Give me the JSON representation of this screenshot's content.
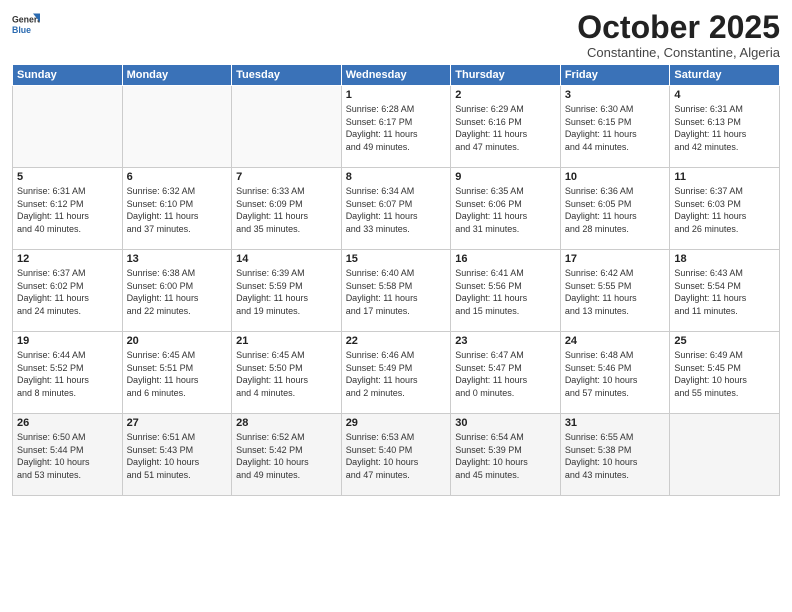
{
  "header": {
    "logo_general": "General",
    "logo_blue": "Blue",
    "month_title": "October 2025",
    "subtitle": "Constantine, Constantine, Algeria"
  },
  "weekdays": [
    "Sunday",
    "Monday",
    "Tuesday",
    "Wednesday",
    "Thursday",
    "Friday",
    "Saturday"
  ],
  "weeks": [
    [
      {
        "day": "",
        "info": ""
      },
      {
        "day": "",
        "info": ""
      },
      {
        "day": "",
        "info": ""
      },
      {
        "day": "1",
        "info": "Sunrise: 6:28 AM\nSunset: 6:17 PM\nDaylight: 11 hours\nand 49 minutes."
      },
      {
        "day": "2",
        "info": "Sunrise: 6:29 AM\nSunset: 6:16 PM\nDaylight: 11 hours\nand 47 minutes."
      },
      {
        "day": "3",
        "info": "Sunrise: 6:30 AM\nSunset: 6:15 PM\nDaylight: 11 hours\nand 44 minutes."
      },
      {
        "day": "4",
        "info": "Sunrise: 6:31 AM\nSunset: 6:13 PM\nDaylight: 11 hours\nand 42 minutes."
      }
    ],
    [
      {
        "day": "5",
        "info": "Sunrise: 6:31 AM\nSunset: 6:12 PM\nDaylight: 11 hours\nand 40 minutes."
      },
      {
        "day": "6",
        "info": "Sunrise: 6:32 AM\nSunset: 6:10 PM\nDaylight: 11 hours\nand 37 minutes."
      },
      {
        "day": "7",
        "info": "Sunrise: 6:33 AM\nSunset: 6:09 PM\nDaylight: 11 hours\nand 35 minutes."
      },
      {
        "day": "8",
        "info": "Sunrise: 6:34 AM\nSunset: 6:07 PM\nDaylight: 11 hours\nand 33 minutes."
      },
      {
        "day": "9",
        "info": "Sunrise: 6:35 AM\nSunset: 6:06 PM\nDaylight: 11 hours\nand 31 minutes."
      },
      {
        "day": "10",
        "info": "Sunrise: 6:36 AM\nSunset: 6:05 PM\nDaylight: 11 hours\nand 28 minutes."
      },
      {
        "day": "11",
        "info": "Sunrise: 6:37 AM\nSunset: 6:03 PM\nDaylight: 11 hours\nand 26 minutes."
      }
    ],
    [
      {
        "day": "12",
        "info": "Sunrise: 6:37 AM\nSunset: 6:02 PM\nDaylight: 11 hours\nand 24 minutes."
      },
      {
        "day": "13",
        "info": "Sunrise: 6:38 AM\nSunset: 6:00 PM\nDaylight: 11 hours\nand 22 minutes."
      },
      {
        "day": "14",
        "info": "Sunrise: 6:39 AM\nSunset: 5:59 PM\nDaylight: 11 hours\nand 19 minutes."
      },
      {
        "day": "15",
        "info": "Sunrise: 6:40 AM\nSunset: 5:58 PM\nDaylight: 11 hours\nand 17 minutes."
      },
      {
        "day": "16",
        "info": "Sunrise: 6:41 AM\nSunset: 5:56 PM\nDaylight: 11 hours\nand 15 minutes."
      },
      {
        "day": "17",
        "info": "Sunrise: 6:42 AM\nSunset: 5:55 PM\nDaylight: 11 hours\nand 13 minutes."
      },
      {
        "day": "18",
        "info": "Sunrise: 6:43 AM\nSunset: 5:54 PM\nDaylight: 11 hours\nand 11 minutes."
      }
    ],
    [
      {
        "day": "19",
        "info": "Sunrise: 6:44 AM\nSunset: 5:52 PM\nDaylight: 11 hours\nand 8 minutes."
      },
      {
        "day": "20",
        "info": "Sunrise: 6:45 AM\nSunset: 5:51 PM\nDaylight: 11 hours\nand 6 minutes."
      },
      {
        "day": "21",
        "info": "Sunrise: 6:45 AM\nSunset: 5:50 PM\nDaylight: 11 hours\nand 4 minutes."
      },
      {
        "day": "22",
        "info": "Sunrise: 6:46 AM\nSunset: 5:49 PM\nDaylight: 11 hours\nand 2 minutes."
      },
      {
        "day": "23",
        "info": "Sunrise: 6:47 AM\nSunset: 5:47 PM\nDaylight: 11 hours\nand 0 minutes."
      },
      {
        "day": "24",
        "info": "Sunrise: 6:48 AM\nSunset: 5:46 PM\nDaylight: 10 hours\nand 57 minutes."
      },
      {
        "day": "25",
        "info": "Sunrise: 6:49 AM\nSunset: 5:45 PM\nDaylight: 10 hours\nand 55 minutes."
      }
    ],
    [
      {
        "day": "26",
        "info": "Sunrise: 6:50 AM\nSunset: 5:44 PM\nDaylight: 10 hours\nand 53 minutes."
      },
      {
        "day": "27",
        "info": "Sunrise: 6:51 AM\nSunset: 5:43 PM\nDaylight: 10 hours\nand 51 minutes."
      },
      {
        "day": "28",
        "info": "Sunrise: 6:52 AM\nSunset: 5:42 PM\nDaylight: 10 hours\nand 49 minutes."
      },
      {
        "day": "29",
        "info": "Sunrise: 6:53 AM\nSunset: 5:40 PM\nDaylight: 10 hours\nand 47 minutes."
      },
      {
        "day": "30",
        "info": "Sunrise: 6:54 AM\nSunset: 5:39 PM\nDaylight: 10 hours\nand 45 minutes."
      },
      {
        "day": "31",
        "info": "Sunrise: 6:55 AM\nSunset: 5:38 PM\nDaylight: 10 hours\nand 43 minutes."
      },
      {
        "day": "",
        "info": ""
      }
    ]
  ]
}
